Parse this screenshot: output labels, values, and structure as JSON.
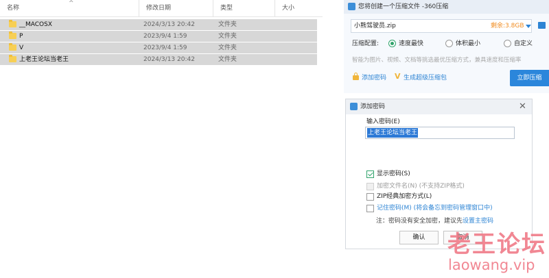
{
  "explorer": {
    "columns": [
      "名称",
      "修改日期",
      "类型",
      "大小"
    ],
    "rows": [
      {
        "name": "__MACOSX",
        "date": "2024/3/13 20:42",
        "type": "文件夹"
      },
      {
        "name": "P",
        "date": "2023/9/4 1:59",
        "type": "文件夹"
      },
      {
        "name": "V",
        "date": "2023/9/4 1:59",
        "type": "文件夹"
      },
      {
        "name": "上老王论坛当老王",
        "date": "2024/3/13 20:42",
        "type": "文件夹"
      }
    ]
  },
  "compress_window": {
    "title": "您将创建一个压缩文件 -360压缩",
    "filename": "小熊驾驶员.zip",
    "free_space": "剩余:3.8GB",
    "config_label": "压缩配置:",
    "options": [
      "速度最快",
      "体积最小",
      "自定义"
    ],
    "selected_option": "速度最快",
    "hint": "智能为图片、视频、文档等挑选最优压缩方式，兼具速度和压缩率",
    "add_password": "添加密码",
    "super_compress": "生成超级压缩包",
    "start_button": "立即压缩"
  },
  "password_dialog": {
    "title": "添加密码",
    "input_label": "输入密码(E)",
    "password_value": "上老王论坛当老王",
    "show_password": {
      "label": "显示密码(S)",
      "checked": true
    },
    "encrypt_filenames": {
      "label": "加密文件名(N) (不支持ZIP格式)",
      "checked": false,
      "disabled": true
    },
    "zip_classic": {
      "label": "ZIP经典加密方式(L)",
      "checked": false
    },
    "remember": {
      "label": "记住密码(M) (将会备忘到密码管理窗口中)",
      "checked": false
    },
    "note_prefix": "注：密码没有安全加密，建议先",
    "note_link": "设置主密码",
    "ok_button": "确认",
    "cancel_button": "取消"
  },
  "watermark": {
    "cn": "老王论坛",
    "en": "laowang.vip"
  },
  "colors": {
    "accent_blue": "#2b86db",
    "accent_green": "#2fa36b",
    "warning_orange": "#f08a1c",
    "watermark_pink": "#f07b88"
  }
}
